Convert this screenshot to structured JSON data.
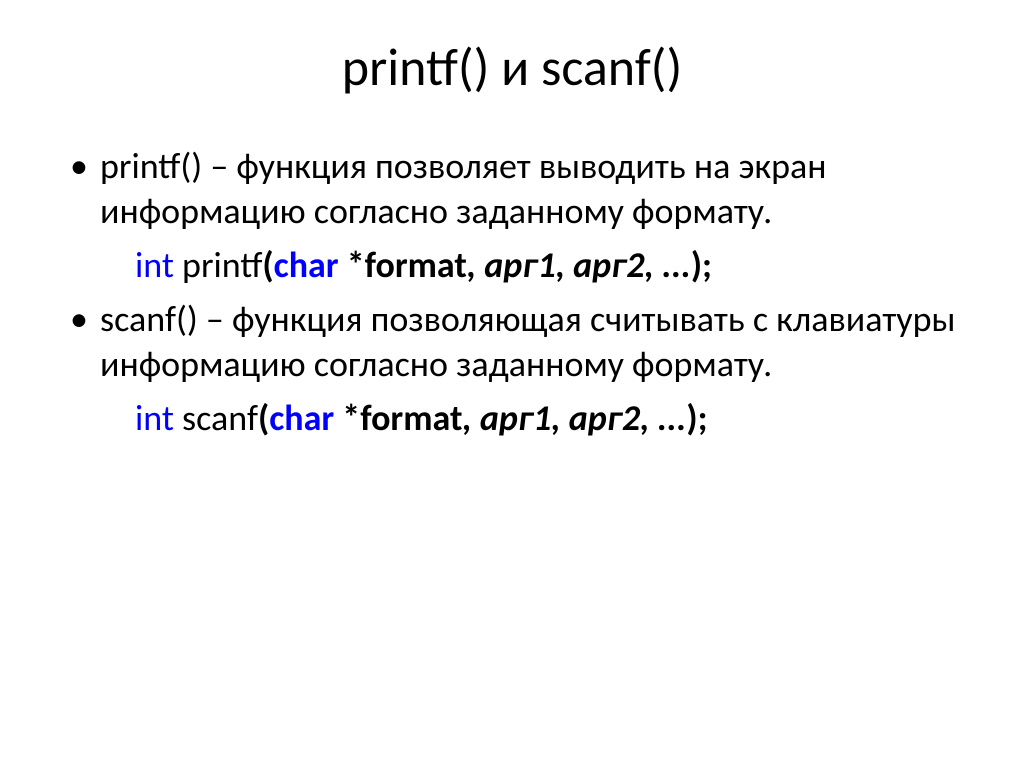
{
  "title": "printf() и scanf()",
  "items": [
    {
      "text": "printf() – функция позволяет выводить на экран информацию согласно заданному формату."
    },
    {
      "code": {
        "int": "int",
        "func": " printf",
        "paren1": "(",
        "char": "char",
        "star_format": " *format",
        "args": ", арг1, арг2, ...",
        "paren2": ");"
      }
    },
    {
      "text": "scanf() – функция позволяющая считывать с клавиатуры информацию согласно заданному формату."
    },
    {
      "code": {
        "int": "int",
        "func": " scanf",
        "paren1": "(",
        "char": "char",
        "star_format": " *format",
        "args": ", арг1, арг2, ...",
        "paren2": ");"
      }
    }
  ]
}
